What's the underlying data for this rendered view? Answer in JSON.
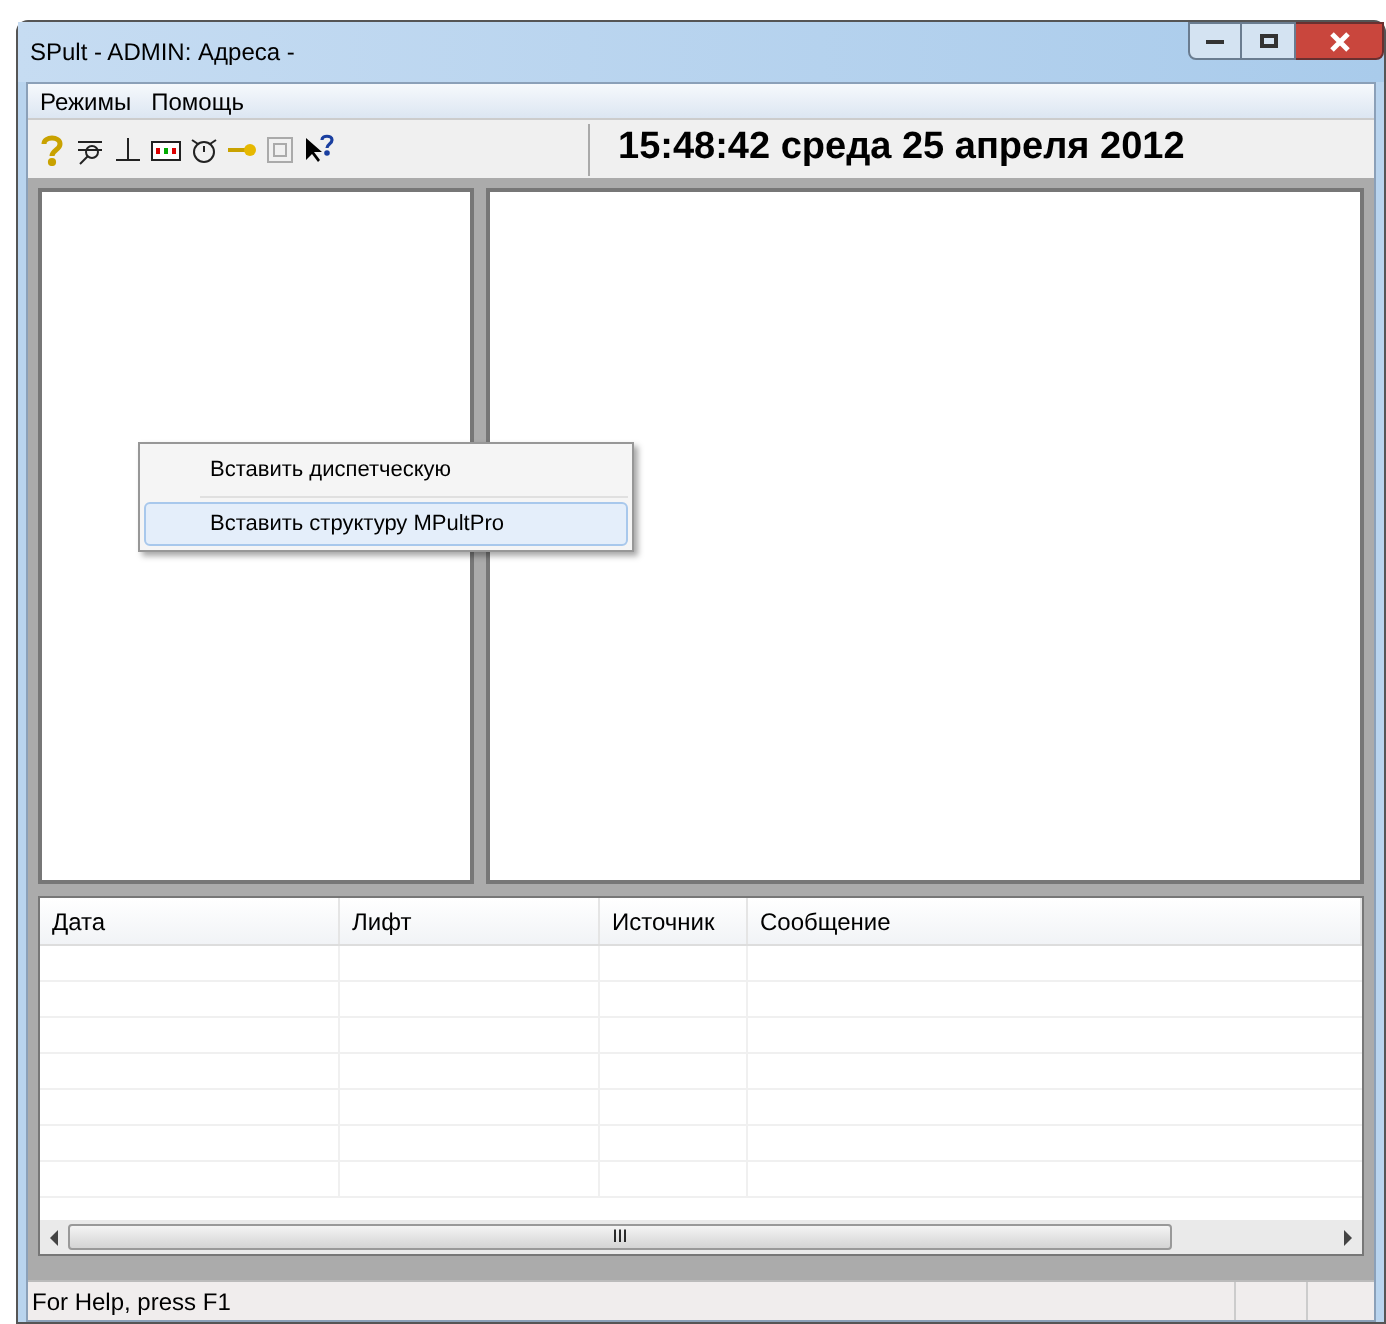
{
  "window": {
    "title": "SPult - ADMIN: Адреса -"
  },
  "menu_bar": [
    "Режимы",
    "Помощь"
  ],
  "clock": "15:48:42 среда 25 апреля 2012",
  "context_menu": [
    {
      "label": "Вставить диспетческую",
      "selected": false
    },
    {
      "label": "Вставить структуру MPultPro",
      "selected": true
    }
  ],
  "table": {
    "columns": [
      "Дата",
      "Лифт",
      "Источник",
      "Сообщение"
    ]
  },
  "scrollbar": {
    "grip": "III"
  },
  "status_bar": "For Help, press F1"
}
